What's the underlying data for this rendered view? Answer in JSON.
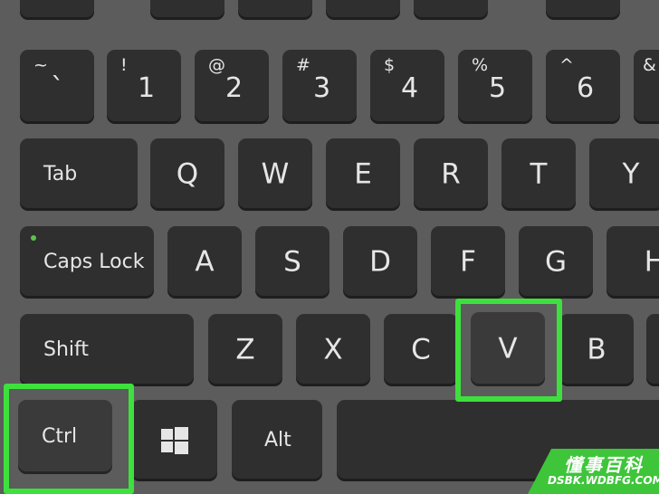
{
  "keyboard": {
    "number_row": [
      {
        "shift": "~",
        "main": "`"
      },
      {
        "shift": "!",
        "main": "1"
      },
      {
        "shift": "@",
        "main": "2"
      },
      {
        "shift": "#",
        "main": "3"
      },
      {
        "shift": "$",
        "main": "4"
      },
      {
        "shift": "%",
        "main": "5"
      },
      {
        "shift": "^",
        "main": "6"
      },
      {
        "shift": "&",
        "main": ""
      }
    ],
    "tab_row": {
      "tab": "Tab",
      "keys": [
        "Q",
        "W",
        "E",
        "R",
        "T",
        "Y"
      ]
    },
    "caps_row": {
      "caps": "Caps Lock",
      "keys": [
        "A",
        "S",
        "D",
        "F",
        "G",
        "H"
      ]
    },
    "shift_row": {
      "shift": "Shift",
      "keys": [
        "Z",
        "X",
        "C",
        "V",
        "B"
      ]
    },
    "bottom_row": {
      "ctrl": "Ctrl",
      "windows_icon": "windows-logo-icon",
      "alt": "Alt"
    }
  },
  "highlighted_keys": [
    "Ctrl",
    "V"
  ],
  "highlight_color": "#3ee03e",
  "caps_lock_led_color": "#5bc44a",
  "watermark": {
    "cn": "懂事百科",
    "en": "DSBK.WDBFG.COM",
    "color": "#3ec53a"
  }
}
